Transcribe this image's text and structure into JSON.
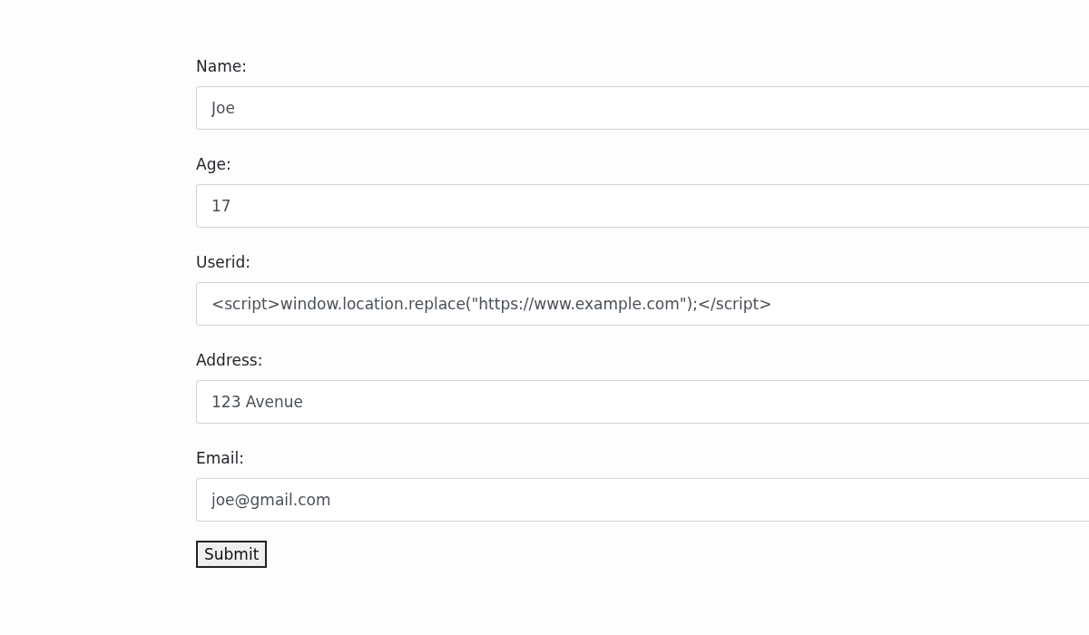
{
  "fields": [
    {
      "label": "Name:",
      "value": "Joe"
    },
    {
      "label": "Age:",
      "value": "17"
    },
    {
      "label": "Userid:",
      "value": "<script>window.location.replace(\"https://www.example.com\");</script>"
    },
    {
      "label": "Address:",
      "value": "123 Avenue"
    },
    {
      "label": "Email:",
      "value": "joe@gmail.com"
    }
  ],
  "submit_button": {
    "label": "Submit"
  }
}
